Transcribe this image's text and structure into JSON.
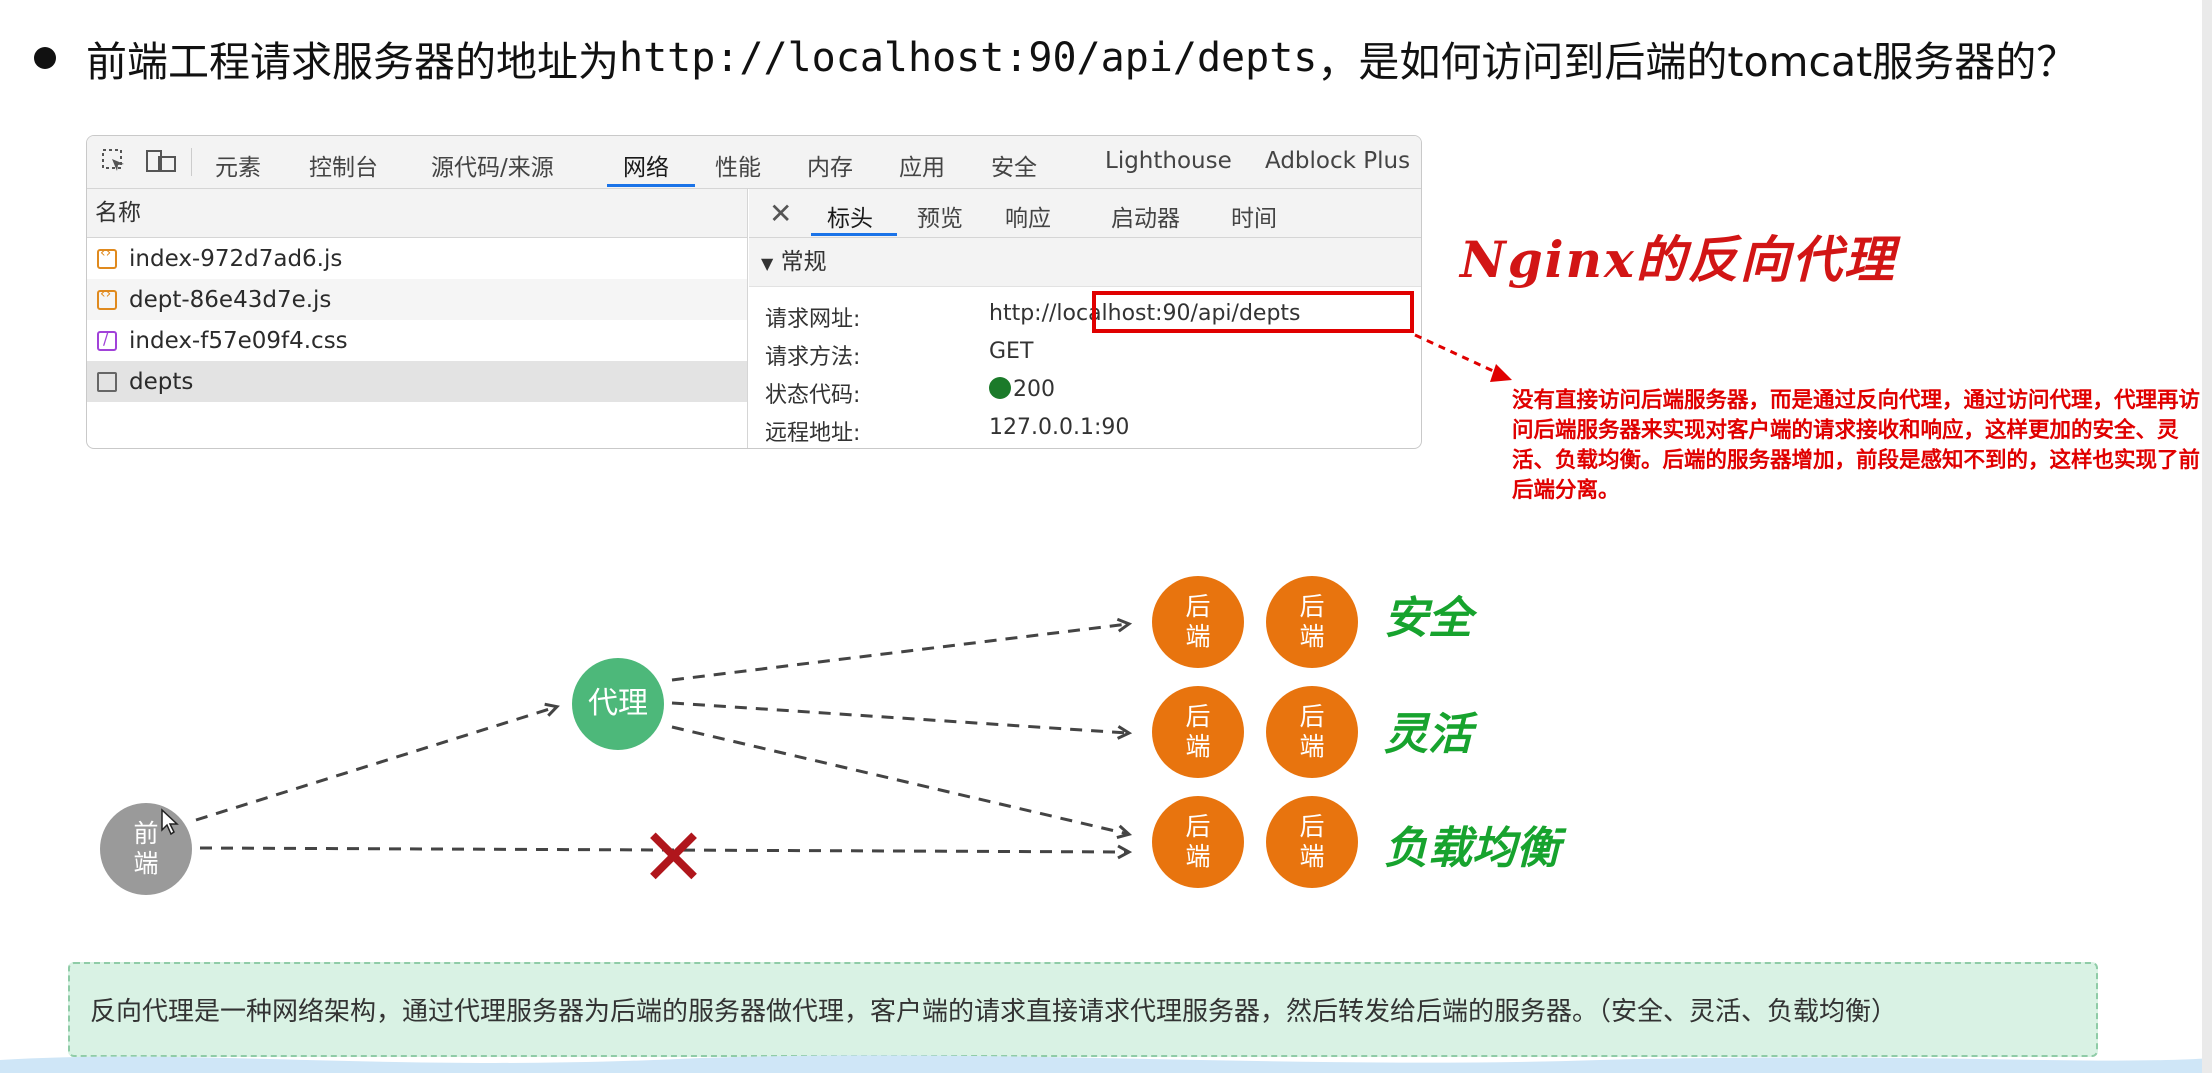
{
  "title": {
    "prefix": "前端工程请求服务器的地址为",
    "url": "http://localhost:90/api/depts",
    "suffix": "，是如何访问到后端的tomcat服务器的？"
  },
  "devtools": {
    "tabs": [
      "元素",
      "控制台",
      "源代码/来源",
      "网络",
      "性能",
      "内存",
      "应用",
      "安全",
      "Lighthouse",
      "Adblock Plus"
    ],
    "active_tab": "网络",
    "name_header": "名称",
    "files": [
      {
        "name": "index-972d7ad6.js",
        "icon": "js-file-icon"
      },
      {
        "name": "dept-86e43d7e.js",
        "icon": "js-file-icon"
      },
      {
        "name": "index-f57e09f4.css",
        "icon": "css-file-icon"
      },
      {
        "name": "depts",
        "icon": "document-icon"
      }
    ],
    "subtabs": [
      "标头",
      "预览",
      "响应",
      "启动器",
      "时间"
    ],
    "active_subtab": "标头",
    "section": "常规",
    "fields": [
      {
        "key": "请求网址:",
        "value": "http://localhost:90/api/depts"
      },
      {
        "key": "请求方法:",
        "value": "GET"
      },
      {
        "key": "状态代码:",
        "value": "200"
      },
      {
        "key": "远程地址:",
        "value": "127.0.0.1:90"
      }
    ]
  },
  "annotation": {
    "title": "Nginx的反向代理",
    "note": "没有直接访问后端服务器，而是通过反向代理，通过访问代理，代理再访问后端服务器来实现对客户端的请求接收和响应，这样更加的安全、灵活、负载均衡。后端的服务器增加，前段是感知不到的，这样也实现了前后端分离。"
  },
  "diagram": {
    "frontend_label": "前\n端",
    "proxy_label": "代理",
    "backend_label": "后\n端",
    "captions": [
      "安全",
      "灵活",
      "负载均衡"
    ]
  },
  "definition": "反向代理是一种网络架构，通过代理服务器为后端的服务器做代理，客户端的请求直接请求代理服务器，然后转发给后端的服务器。（安全、灵活、负载均衡）",
  "colors": {
    "accent_red": "#e00000",
    "proxy_green": "#4db87a",
    "backend_orange": "#e8740e",
    "caption_green": "#17a32e",
    "frontend_gray": "#9a9a9a"
  }
}
